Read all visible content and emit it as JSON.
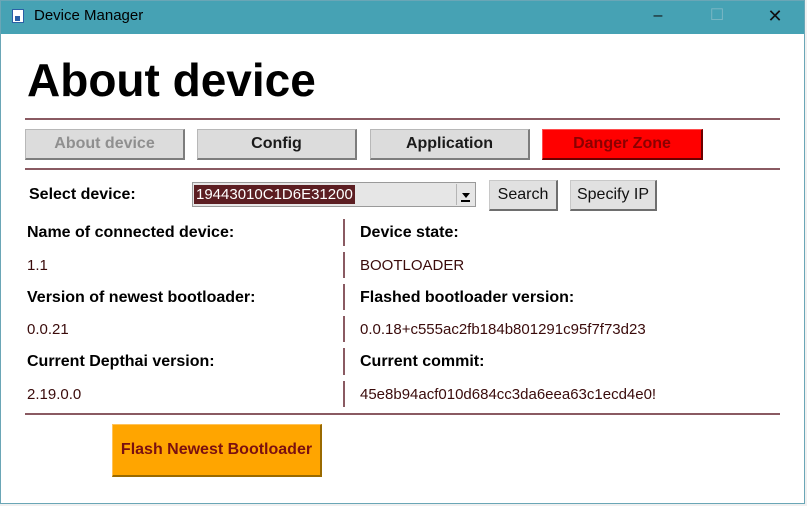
{
  "window": {
    "title": "Device Manager",
    "app_icon": "device-manager-icon",
    "controls": {
      "minimize": "–",
      "maximize": "☐",
      "close": "✕"
    }
  },
  "page": {
    "title": "About device"
  },
  "tabs": [
    {
      "label": "About device",
      "state": "disabled"
    },
    {
      "label": "Config"
    },
    {
      "label": "Application"
    },
    {
      "label": "Danger Zone",
      "color": "#ff0000"
    }
  ],
  "device_select": {
    "label": "Select device:",
    "selected": "19443010C1D6E31200",
    "search_label": "Search",
    "specify_ip_label": "Specify IP"
  },
  "info": {
    "left": [
      {
        "label": "Name of connected device:",
        "value": "1.1"
      },
      {
        "label": "Version of newest bootloader:",
        "value": "0.0.21"
      },
      {
        "label": "Current Depthai version:",
        "value": "2.19.0.0"
      }
    ],
    "right": [
      {
        "label": "Device state:",
        "value": "BOOTLOADER"
      },
      {
        "label": "Flashed bootloader version:",
        "value": "0.0.18+c555ac2fb184b801291c95f7f73d23"
      },
      {
        "label": "Current commit:",
        "value": "45e8b94acf010d684cc3da6eea63c1ecd4e0!"
      }
    ]
  },
  "flash_button": {
    "label": "Flash Newest Bootloader",
    "color": "#ffa500"
  },
  "colors": {
    "titlebar": "#46a2b4",
    "divider": "#8a5a62",
    "danger": "#ff0000",
    "accent_orange": "#ffa500"
  }
}
